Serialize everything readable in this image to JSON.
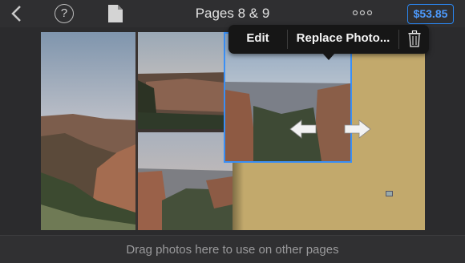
{
  "header": {
    "title": "Pages 8 & 9",
    "price": "$53.85",
    "icons": [
      "back-icon",
      "help-icon",
      "page-icon",
      "more-icon"
    ]
  },
  "popup": {
    "edit_label": "Edit",
    "replace_label": "Replace Photo...",
    "icons": [
      "trash-icon"
    ]
  },
  "footer": {
    "hint": "Drag photos here to use on other pages"
  },
  "colors": {
    "accent": "#3a8ff5",
    "page_background": "#c2a96c",
    "chrome": "#2f2f31"
  }
}
